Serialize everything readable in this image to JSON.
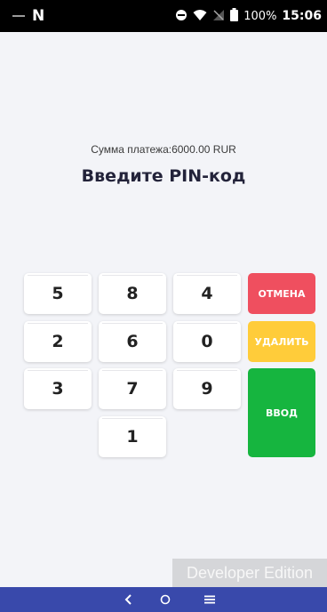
{
  "status_bar": {
    "battery_percent": "100%",
    "time": "15:06",
    "carrier_icon": "n-icon"
  },
  "payment": {
    "amount_text": "Сумма платежа:6000.00 RUR",
    "title": "Введите PIN-код"
  },
  "keypad": {
    "keys": [
      "5",
      "8",
      "4",
      "2",
      "6",
      "0",
      "3",
      "7",
      "9",
      "1"
    ],
    "cancel_label": "ОТМЕНА",
    "delete_label": "УДАЛИТЬ",
    "enter_label": "ВВОД"
  },
  "watermark": {
    "text": "Developer Edition"
  },
  "colors": {
    "cancel": "#ef4f5f",
    "delete": "#ffcc3a",
    "enter": "#16b53f",
    "nav_bar": "#3949ab",
    "background": "#f3f4f8"
  }
}
